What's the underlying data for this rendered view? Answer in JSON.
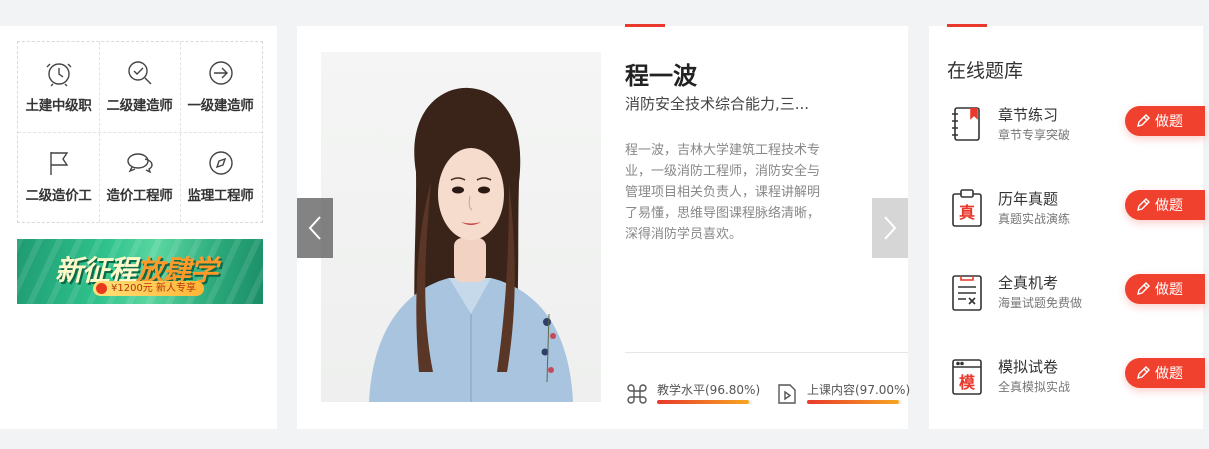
{
  "categories": [
    {
      "label": "土建中级职",
      "icon": "alarm-clock-icon"
    },
    {
      "label": "二级建造师",
      "icon": "magnify-check-icon"
    },
    {
      "label": "一级建造师",
      "icon": "enter-arrow-icon"
    },
    {
      "label": "二级造价工",
      "icon": "flag-icon"
    },
    {
      "label": "造价工程师",
      "icon": "chat-bubbles-icon"
    },
    {
      "label": "监理工程师",
      "icon": "compass-icon"
    }
  ],
  "banner": {
    "title_part1": "新征程",
    "title_part2": "放肆学",
    "promo": "¥1200元 新人专享"
  },
  "teacher": {
    "name": "程一波",
    "subject": "消防安全技术综合能力,三...",
    "description": "程一波，吉林大学建筑工程技术专业，一级消防工程师，消防安全与管理项目相关负责人，课程讲解明了易懂，思维导图课程脉络清晰，深得消防学员喜欢。",
    "stats": [
      {
        "label": "教学水平(96.80%)",
        "value": 0.968,
        "icon": "command-key-icon"
      },
      {
        "label": "上课内容(97.00%)",
        "value": 0.97,
        "icon": "play-document-icon"
      }
    ]
  },
  "question_bank": {
    "title": "在线题库",
    "button_label": "做题",
    "items": [
      {
        "name": "章节练习",
        "sub": "章节专享突破",
        "icon": "notebook-icon"
      },
      {
        "name": "历年真题",
        "sub": "真题实战演练",
        "icon": "clipboard-true-icon",
        "icon_text": "真"
      },
      {
        "name": "全真机考",
        "sub": "海量试题免费做",
        "icon": "exam-paper-icon"
      },
      {
        "name": "模拟试卷",
        "sub": "全真模拟实战",
        "icon": "mock-paper-icon",
        "icon_text": "模"
      }
    ]
  },
  "colors": {
    "accent": "#e8392c",
    "button": "#f0402e"
  }
}
